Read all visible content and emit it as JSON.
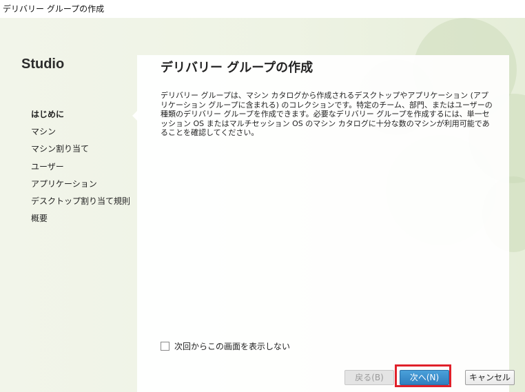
{
  "window": {
    "title": "デリバリー グループの作成"
  },
  "sidebar": {
    "brand": "Studio",
    "items": [
      {
        "label": "はじめに",
        "active": true
      },
      {
        "label": "マシン",
        "active": false
      },
      {
        "label": "マシン割り当て",
        "active": false
      },
      {
        "label": "ユーザー",
        "active": false
      },
      {
        "label": "アプリケーション",
        "active": false
      },
      {
        "label": "デスクトップ割り当て規則",
        "active": false
      },
      {
        "label": "概要",
        "active": false
      }
    ]
  },
  "main": {
    "title": "デリバリー グループの作成",
    "description": "デリバリー グループは、マシン カタログから作成されるデスクトップやアプリケーション (アプリケーション グループに含まれる) のコレクションです。特定のチーム、部門、またはユーザーの種類のデリバリー グループを作成できます。必要なデリバリー グループを作成するには、単一セッション OS またはマルチセッション OS のマシン カタログに十分な数のマシンが利用可能であることを確認してください。",
    "dont_show_label": "次回からこの画面を表示しない",
    "dont_show_checked": false
  },
  "buttons": {
    "back": "戻る(B)",
    "next": "次へ(N)",
    "cancel": "キャンセル"
  },
  "colors": {
    "accent": "#2f7fbf",
    "highlight": "#e0202a",
    "background_tint": "#eef3e4"
  }
}
